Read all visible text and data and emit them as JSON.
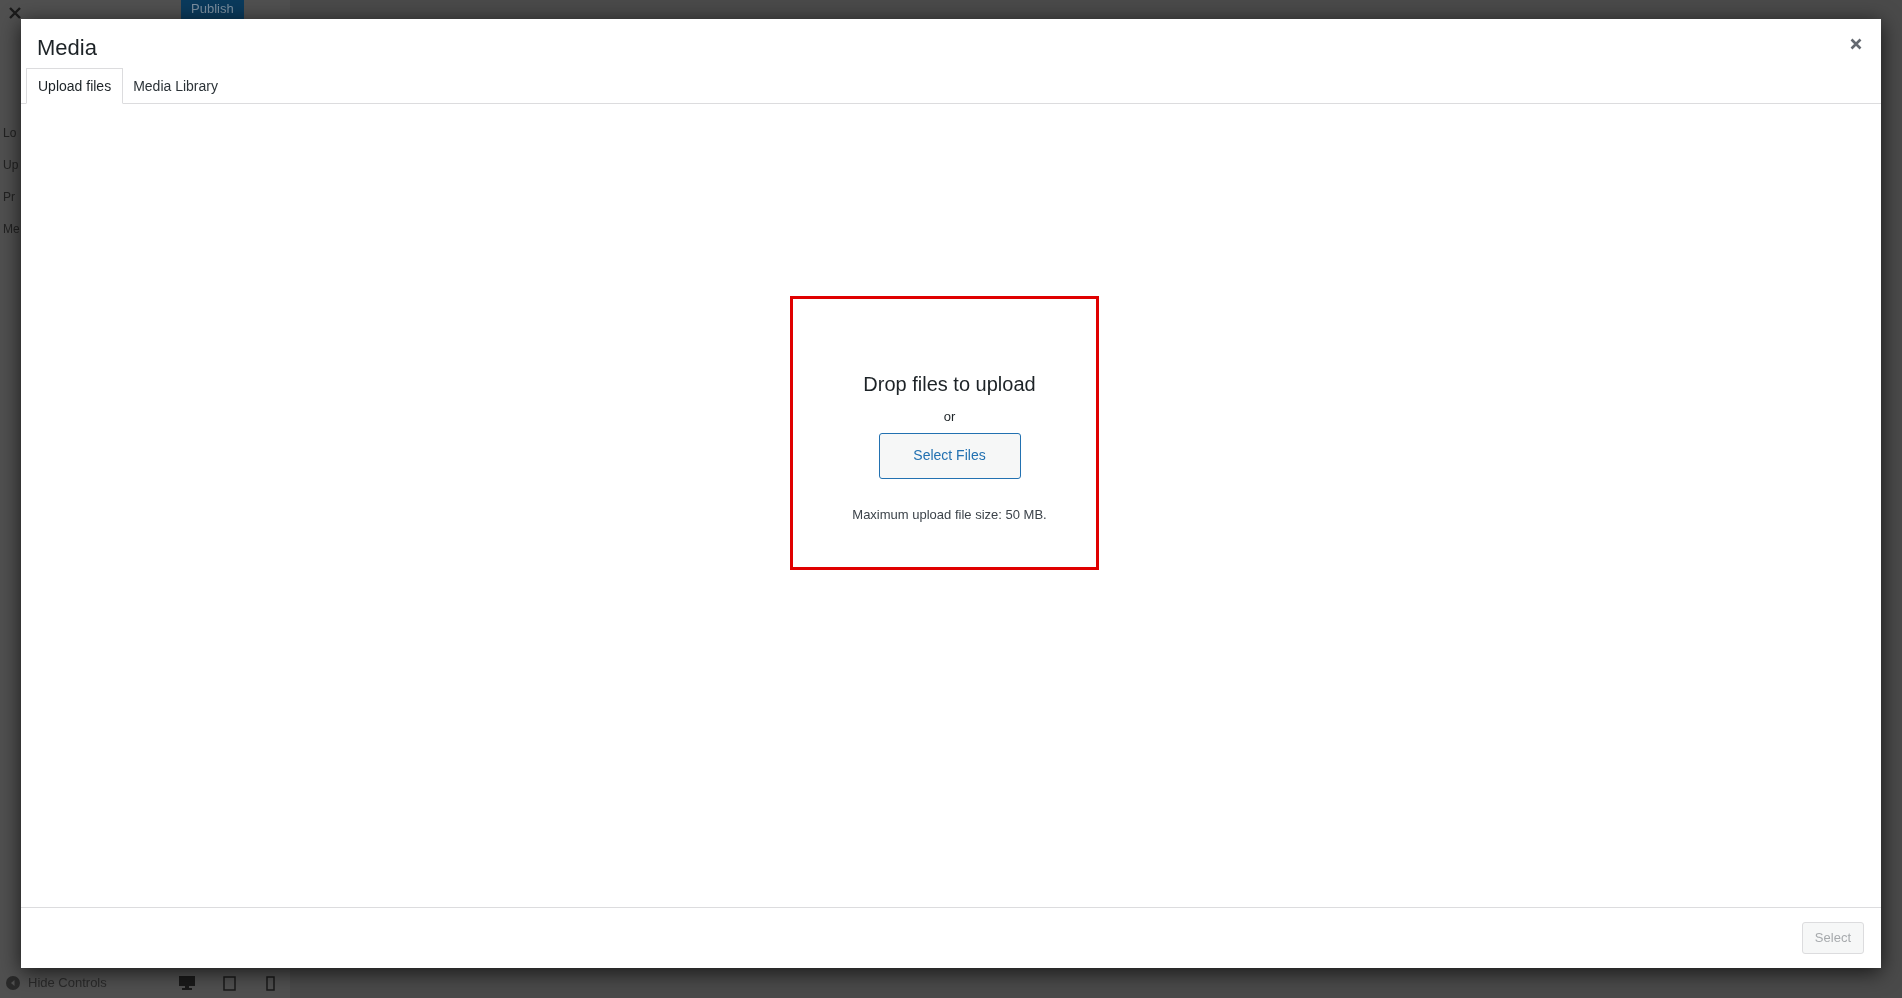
{
  "background": {
    "publish_button": "Publish",
    "sidebar_fragments": [
      "Lo",
      "Up",
      "Pr",
      "Me"
    ],
    "hide_controls": "Hide Controls"
  },
  "modal": {
    "title": "Media",
    "tabs": [
      {
        "label": "Upload files",
        "selected": true
      },
      {
        "label": "Media Library",
        "selected": false
      }
    ],
    "drop_zone": {
      "heading": "Drop files to upload",
      "separator": "or",
      "button": "Select Files",
      "note": "Maximum upload file size: 50 MB.",
      "highlighted": true
    },
    "footer": {
      "button": "Select",
      "disabled": true
    }
  }
}
